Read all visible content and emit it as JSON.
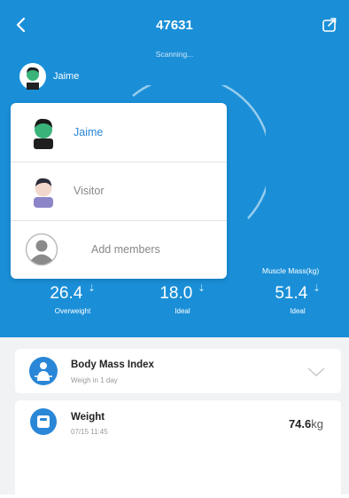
{
  "header": {
    "title": "47631",
    "status": "Scanning..."
  },
  "current_user": {
    "name": "Jaime"
  },
  "member_menu": {
    "items": [
      {
        "label": "Jaime",
        "active": true
      },
      {
        "label": "Visitor",
        "active": false
      },
      {
        "label": "Add members",
        "active": false
      }
    ]
  },
  "stats": {
    "third_label": "Muscle Mass(kg)",
    "items": [
      {
        "value": "26.4",
        "status": "Overweight"
      },
      {
        "value": "18.0",
        "status": "Ideal"
      },
      {
        "value": "51.4",
        "status": "Ideal"
      }
    ]
  },
  "cards": {
    "bmi": {
      "title": "Body Mass Index",
      "subtitle": "Weigh in 1 day"
    },
    "weight": {
      "title": "Weight",
      "subtitle": "07/15 11:45",
      "value": "74.6",
      "unit": "kg"
    }
  },
  "colors": {
    "accent": "#1a8fd8",
    "active_text": "#2a86d6"
  }
}
